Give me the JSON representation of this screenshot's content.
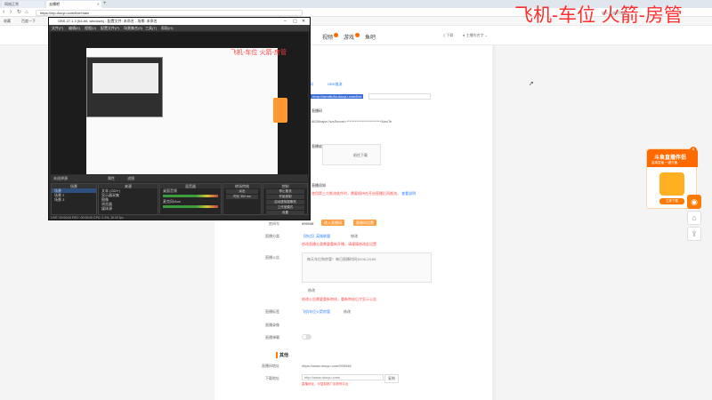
{
  "browser": {
    "tabs": [
      {
        "label": "网络正常"
      },
      {
        "label": "去播吧"
      }
    ],
    "address": "https://mp.douyu.com/live/main",
    "bookmarks": [
      "收藏",
      "百度一下"
    ]
  },
  "site": {
    "nav": [
      "视频",
      "游戏",
      "鱼吧"
    ],
    "right": [
      "下载",
      "主播的名字"
    ]
  },
  "overlay": {
    "title": "飞机-车位  火箭-房管",
    "sub": "输入关键字搜索"
  },
  "form": {
    "rtmp_label": "推流地址",
    "rtmp_tabs": [
      "直播码",
      "OBS推流"
    ],
    "rtmp_url": "rtmp://sendtc3a.douyu.com/live",
    "code_label": "直播码",
    "code_val": "8826hajsn?wsSecret=*************************&wsTe",
    "tool_label": "直播软件",
    "tool_btn": "前往下载",
    "note_label": "直播须知",
    "note_text": "使用第三方推流软件时，需要保持在开启直播后再推流，",
    "note_link": "查看说明",
    "room_label": "房间号",
    "room_val": "995948",
    "room_btns": [
      "进入直播间",
      "直播间设置"
    ],
    "cat_label": "直播分类",
    "cat_val": "【热点】英雄联盟",
    "cat_edit": "修改",
    "cat_warn": "修改直播分类需要重新开播，请谨慎修改此设置",
    "notice_label": "直播公告",
    "notice_text": "每天车位和房管！每日直播时间19:00-24:00",
    "notice_edit": "修改",
    "notice_warn": "修改公告需要重新审核，重新审核后才显示公告",
    "tag_label": "直播标签",
    "tag_val": "飞机车位火箭房管",
    "tag_edit": "修改",
    "rec_label": "直播录像",
    "danmu_label": "直播弹幕",
    "other_title": "其他",
    "share_label": "直播间地址",
    "share_val": "https://www.douyu.com/995948",
    "flash_label": "下载地址",
    "flash_val": "http://www.douyu.com/",
    "flash_btn": "复制",
    "flash_note": "直播地址，可复制推广到其他平台"
  },
  "ad": {
    "title": "斗鱼直播伴侣",
    "sub": "高清直播 一键开播",
    "btn": "立即下载"
  },
  "obs": {
    "title": "OBS 27.1.3 (64-bit, windows) - 配置文件: 未命名 - 场景: 未命名",
    "menu": [
      "文件(F)",
      "编辑(E)",
      "视图(V)",
      "配置文件(P)",
      "场景集合(S)",
      "工具(T)",
      "帮助(H)"
    ],
    "bar": [
      "未选择源",
      "属性",
      "滤镜"
    ],
    "scenes_head": "场景",
    "scenes": [
      "场景",
      "场景 2",
      "场景 3"
    ],
    "sources_head": "来源",
    "sources": [
      "文本 (GDI+)",
      "显示器采集",
      "图像",
      "浏览器",
      "媒体源"
    ],
    "mixer_head": "混音器",
    "mixer": [
      "桌面音频",
      "麦克风/Aux"
    ],
    "trans_head": "转场特效",
    "trans": [
      "淡出",
      "时长 300 ms"
    ],
    "ctrl_head": "控制",
    "ctrl": [
      "停止推流",
      "开始录制",
      "启动虚拟摄像机",
      "工作室模式",
      "设置",
      "退出"
    ],
    "status": "LIVE: 00:00:00  REC: 00:00:00  CPU: 2.4%, 30.00 fps"
  }
}
